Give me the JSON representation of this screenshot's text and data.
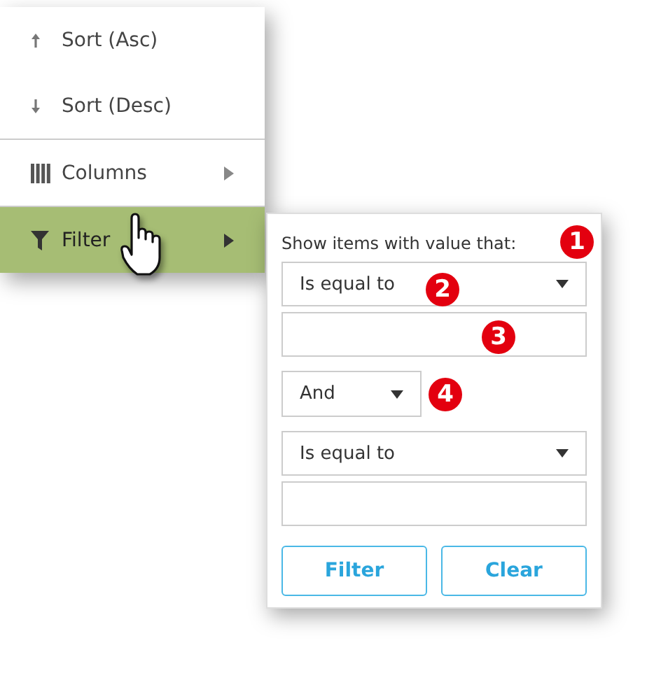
{
  "menu": {
    "items": [
      {
        "kind": "sort_asc",
        "label": "Sort (Asc)",
        "selected": false
      },
      {
        "kind": "sort_desc",
        "label": "Sort (Desc)",
        "selected": false
      },
      {
        "kind": "columns",
        "label": "Columns",
        "selected": false
      },
      {
        "kind": "filter",
        "label": "Filter",
        "selected": true
      }
    ]
  },
  "filter_popup": {
    "prompt": "Show items with value that:",
    "operator_1": "Is equal to",
    "logic": "And",
    "operator_2": "Is equal to",
    "buttons": [
      "Filter",
      "Clear"
    ]
  },
  "callouts": [
    "1",
    "2",
    "3",
    "4"
  ]
}
